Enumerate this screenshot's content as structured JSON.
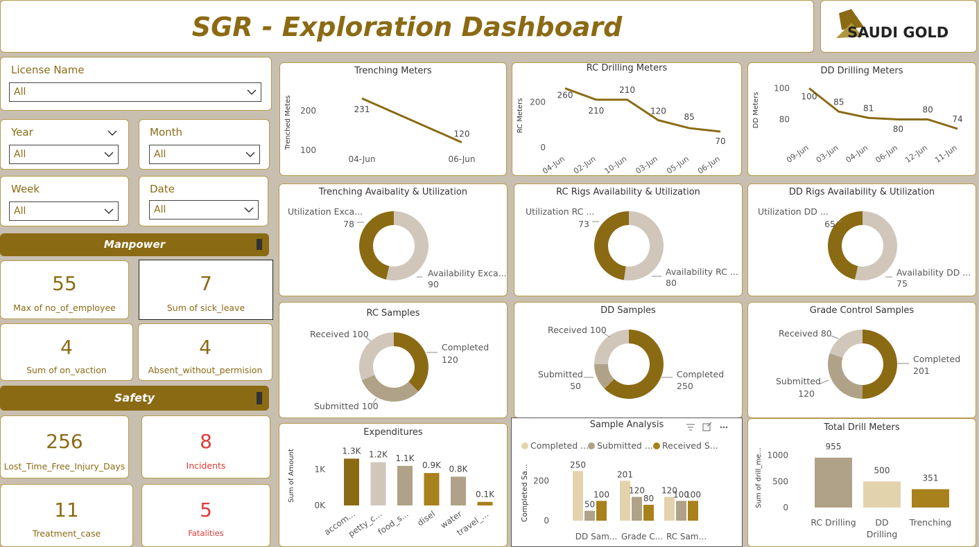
{
  "header": {
    "title": "SGR - Exploration Dashboard",
    "logo_text": "SAUDI GOLD"
  },
  "colors": {
    "gold": "#8b6a14",
    "light": "#d0c6ba",
    "mid": "#b0a288",
    "beige": "#e3d3ad",
    "red": "#e03a3a"
  },
  "filters": {
    "license": {
      "label": "License Name",
      "value": "All"
    },
    "year": {
      "label": "Year",
      "value": "All"
    },
    "month": {
      "label": "Month",
      "value": "All"
    },
    "week": {
      "label": "Week",
      "value": "All"
    },
    "date": {
      "label": "Date",
      "value": "All"
    }
  },
  "manpower": {
    "title": "Manpower",
    "kpis": [
      {
        "value": "55",
        "label": "Max of no_of_employee"
      },
      {
        "value": "7",
        "label": "Sum of sick_leave"
      },
      {
        "value": "4",
        "label": "Sum of on_vaction"
      },
      {
        "value": "4",
        "label": "Absent_without_permision"
      }
    ]
  },
  "safety": {
    "title": "Safety",
    "kpis": [
      {
        "value": "256",
        "label": "Lost_Time_Free_Injury_Days"
      },
      {
        "value": "8",
        "label": "Incidents"
      },
      {
        "value": "11",
        "label": "Treatment_case"
      },
      {
        "value": "5",
        "label": "Fatalities"
      }
    ]
  },
  "chart_data": [
    {
      "id": "trenching",
      "type": "line",
      "title": "Trenching Meters",
      "ylabel": "Trenched Metes",
      "categories": [
        "04-Jun",
        "06-Jun"
      ],
      "values": [
        231,
        120
      ],
      "yticks": [
        "200",
        "100"
      ],
      "ylim": [
        100,
        240
      ]
    },
    {
      "id": "rc",
      "type": "line",
      "title": "RC Drilling Meters",
      "ylabel": "RC Meters",
      "categories": [
        "04-Jun",
        "02-Jun",
        "10-Jun",
        "03-Jun",
        "05-Jun",
        "06-Jun"
      ],
      "values": [
        260,
        210,
        210,
        120,
        85,
        70
      ],
      "yticks": [
        "200",
        "0"
      ],
      "ylim": [
        0,
        280
      ]
    },
    {
      "id": "dd",
      "type": "line",
      "title": "DD Drilling Meters",
      "ylabel": "DD Meters",
      "categories": [
        "09-Jun",
        "03-Jun",
        "04-Jun",
        "06-Jun",
        "12-Jun",
        "11-Jun"
      ],
      "values": [
        100,
        85,
        81,
        80,
        80,
        74
      ],
      "yticks": [
        "100",
        "80"
      ],
      "ylim": [
        70,
        102
      ]
    },
    {
      "id": "trench_avail",
      "type": "pie",
      "title": "Trenching Avaibality & Utilization",
      "slices": [
        {
          "label": "Availability Exca...",
          "value": 90,
          "color": "#d0c6ba"
        },
        {
          "label": "Utilization Exca...",
          "value": 78,
          "color": "#8b6a14"
        }
      ]
    },
    {
      "id": "rc_avail",
      "type": "pie",
      "title": "RC Rigs Availability & Utilization",
      "slices": [
        {
          "label": "Availability RC ...",
          "value": 80,
          "color": "#d0c6ba"
        },
        {
          "label": "Utilization RC ...",
          "value": 73,
          "color": "#8b6a14"
        }
      ]
    },
    {
      "id": "dd_avail",
      "type": "pie",
      "title": "DD Rigs Availability & Utilization",
      "slices": [
        {
          "label": "Availability DD ...",
          "value": 75,
          "color": "#d0c6ba"
        },
        {
          "label": "Utilization DD ...",
          "value": 65,
          "color": "#8b6a14"
        }
      ]
    },
    {
      "id": "rc_samples",
      "type": "pie",
      "title": "RC Samples",
      "slices": [
        {
          "label": "Completed",
          "value": 120,
          "color": "#8b6a14"
        },
        {
          "label": "Submitted",
          "value": 100,
          "color": "#b0a288"
        },
        {
          "label": "Received",
          "value": 100,
          "color": "#d0c6ba"
        }
      ]
    },
    {
      "id": "dd_samples",
      "type": "pie",
      "title": "DD Samples",
      "slices": [
        {
          "label": "Completed",
          "value": 250,
          "color": "#8b6a14"
        },
        {
          "label": "Submitted",
          "value": 50,
          "color": "#b0a288"
        },
        {
          "label": "Received",
          "value": 100,
          "color": "#d0c6ba"
        }
      ]
    },
    {
      "id": "gc_samples",
      "type": "pie",
      "title": "Grade Control Samples",
      "slices": [
        {
          "label": "Completed",
          "value": 201,
          "color": "#8b6a14"
        },
        {
          "label": "Submitted",
          "value": 120,
          "color": "#b0a288"
        },
        {
          "label": "Received",
          "value": 80,
          "color": "#d0c6ba"
        }
      ]
    },
    {
      "id": "expenditures",
      "type": "bar",
      "title": "Expenditures",
      "ylabel": "Sum of Amount",
      "categories": [
        "accom...",
        "petty_c...",
        "food_s...",
        "disel",
        "water",
        "travel_..."
      ],
      "values": [
        1300,
        1200,
        1100,
        900,
        800,
        100
      ],
      "labels": [
        "1.3K",
        "1.2K",
        "1.1K",
        "0.9K",
        "0.8K",
        "0.1K"
      ],
      "colors": [
        "#8b6a14",
        "#d0c6ba",
        "#b0a288",
        "#a8801c",
        "#b0a288",
        "#a8801c"
      ],
      "yticks": [
        "1K",
        "0K"
      ],
      "ylim": [
        0,
        1500
      ]
    },
    {
      "id": "sample_analysis",
      "type": "bar",
      "title": "Sample Analysis",
      "ylabel": "Completed Sa...",
      "legend": [
        "Completed ...",
        "Submitted ...",
        "Received S..."
      ],
      "categories": [
        "DD Sam...",
        "Grade C...",
        "RC Sam..."
      ],
      "series": [
        {
          "name": "Completed ...",
          "values": [
            250,
            201,
            120
          ],
          "color": "#e3d3ad"
        },
        {
          "name": "Submitted ...",
          "values": [
            50,
            120,
            100
          ],
          "color": "#b0a288"
        },
        {
          "name": "Received S...",
          "values": [
            100,
            80,
            100
          ],
          "color": "#a8801c"
        }
      ],
      "yticks": [
        "200",
        "0"
      ],
      "ylim": [
        0,
        300
      ]
    },
    {
      "id": "total_drill",
      "type": "bar",
      "title": "Total Drill Meters",
      "ylabel": "Sum of drill_me...",
      "categories": [
        "RC Drilling",
        "DD Drilling",
        "Trenching"
      ],
      "values": [
        955,
        500,
        351
      ],
      "colors": [
        "#b0a288",
        "#e3d3ad",
        "#a8801c"
      ],
      "yticks": [
        "1000",
        "500",
        "0"
      ],
      "ylim": [
        0,
        1100
      ]
    }
  ]
}
